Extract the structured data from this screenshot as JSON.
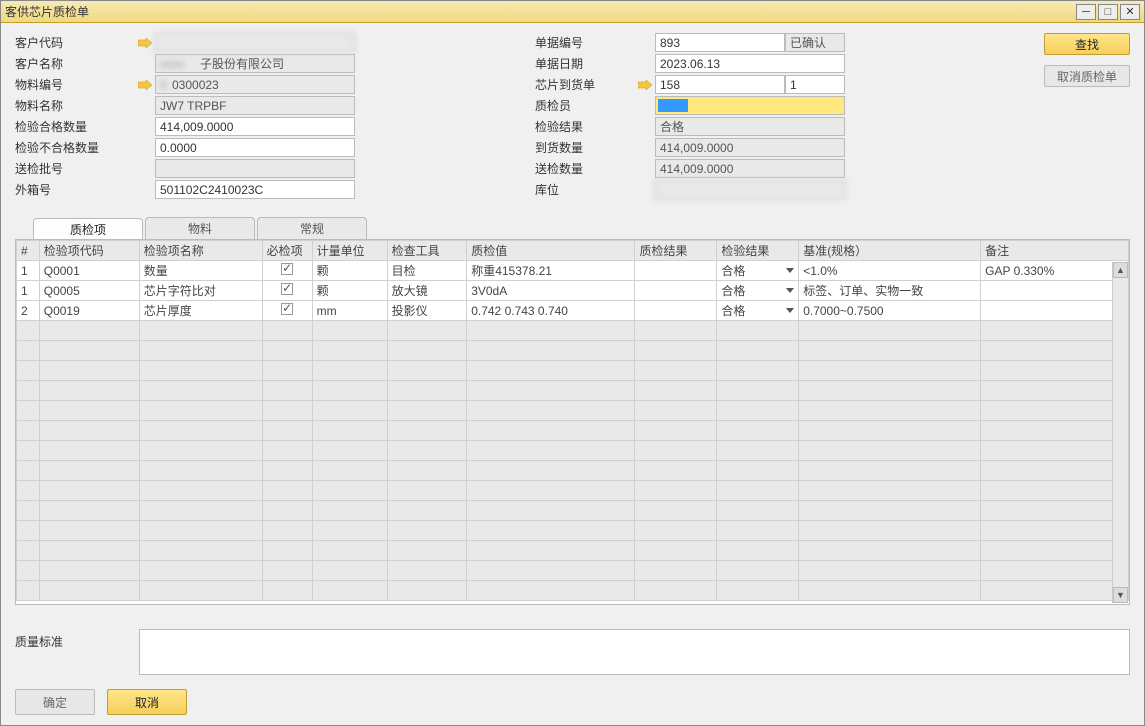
{
  "window": {
    "title": "客供芯片质检单"
  },
  "left_fields": {
    "customer_code": {
      "label": "客户代码",
      "value": ""
    },
    "customer_name": {
      "label": "客户名称",
      "value": "子股份有限公司"
    },
    "material_code": {
      "label": "物料编号",
      "value": "0300023"
    },
    "material_name": {
      "label": "物料名称",
      "value": "JW7            TRPBF"
    },
    "pass_qty": {
      "label": "检验合格数量",
      "value": "414,009.0000"
    },
    "fail_qty": {
      "label": "检验不合格数量",
      "value": "0.0000"
    },
    "batch_no": {
      "label": "送检批号",
      "value": ""
    },
    "carton_no": {
      "label": "外箱号",
      "value": "501102C2410023C"
    }
  },
  "right_fields": {
    "doc_no": {
      "label": "单据编号",
      "value": "893",
      "status": "已确认"
    },
    "doc_date": {
      "label": "单据日期",
      "value": "2023.06.13"
    },
    "chip_recv": {
      "label": "芯片到货单",
      "value": "158",
      "extra": "1"
    },
    "inspector": {
      "label": "质检员",
      "value": ""
    },
    "result": {
      "label": "检验结果",
      "value": "合格"
    },
    "recv_qty": {
      "label": "到货数量",
      "value": "414,009.0000"
    },
    "send_qty": {
      "label": "送检数量",
      "value": "414,009.0000"
    },
    "loc": {
      "label": "库位",
      "value": ""
    }
  },
  "actions": {
    "search": "查找",
    "cancel_doc": "取消质检单",
    "ok": "确定",
    "cancel": "取消"
  },
  "tabs": {
    "t1": "质检项",
    "t2": "物料",
    "t3": "常规"
  },
  "grid": {
    "headers": {
      "idx": "#",
      "code": "检验项代码",
      "name": "检验项名称",
      "required": "必检项",
      "unit": "计量单位",
      "tool": "检查工具",
      "value": "质检值",
      "qresult": "质检结果",
      "iresult": "检验结果",
      "std": "基准(规格）",
      "remark": "备注"
    },
    "rows": [
      {
        "idx": "1",
        "code": "Q0001",
        "name": "数量",
        "required": true,
        "unit": "颗",
        "tool": "目检",
        "value": "称重415378.21",
        "qresult": "",
        "iresult": "合格",
        "std": "<1.0%",
        "remark": "GAP 0.330%"
      },
      {
        "idx": "1",
        "code": "Q0005",
        "name": "芯片字符比对",
        "required": true,
        "unit": "颗",
        "tool": "放大镜",
        "value": "3V0dA",
        "qresult": "",
        "iresult": "合格",
        "std": "标签、订单、实物一致",
        "remark": ""
      },
      {
        "idx": "2",
        "code": "Q0019",
        "name": "芯片厚度",
        "required": true,
        "unit": "mm",
        "tool": "投影仪",
        "value": "0.742 0.743 0.740",
        "qresult": "",
        "iresult": "合格",
        "std": "0.7000~0.7500",
        "remark": ""
      }
    ]
  },
  "quality_std": {
    "label": "质量标准",
    "value": ""
  }
}
